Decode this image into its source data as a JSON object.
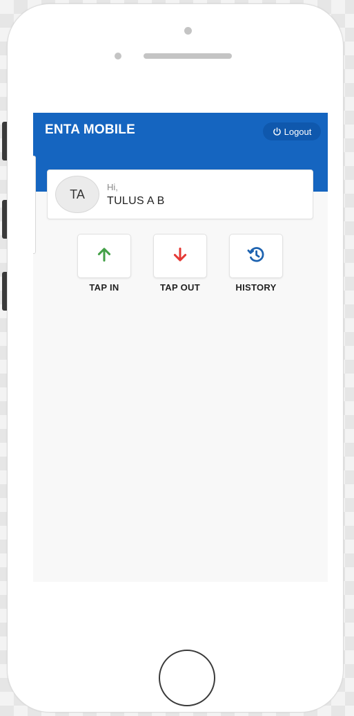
{
  "header": {
    "app_title": "ENTA MOBILE",
    "logout_label": "Logout"
  },
  "user": {
    "initials": "TA",
    "greeting": "Hi,",
    "name": "TULUS A B"
  },
  "actions": [
    {
      "label": "TAP IN",
      "icon": "arrow-up-icon",
      "color": "#43a047"
    },
    {
      "label": "TAP OUT",
      "icon": "arrow-down-icon",
      "color": "#e53935"
    },
    {
      "label": "HISTORY",
      "icon": "history-icon",
      "color": "#1e63b0"
    }
  ],
  "colors": {
    "header_blue": "#1565c0",
    "logout_bg": "#0f58ad",
    "screen_bg": "#f8f8f8"
  }
}
